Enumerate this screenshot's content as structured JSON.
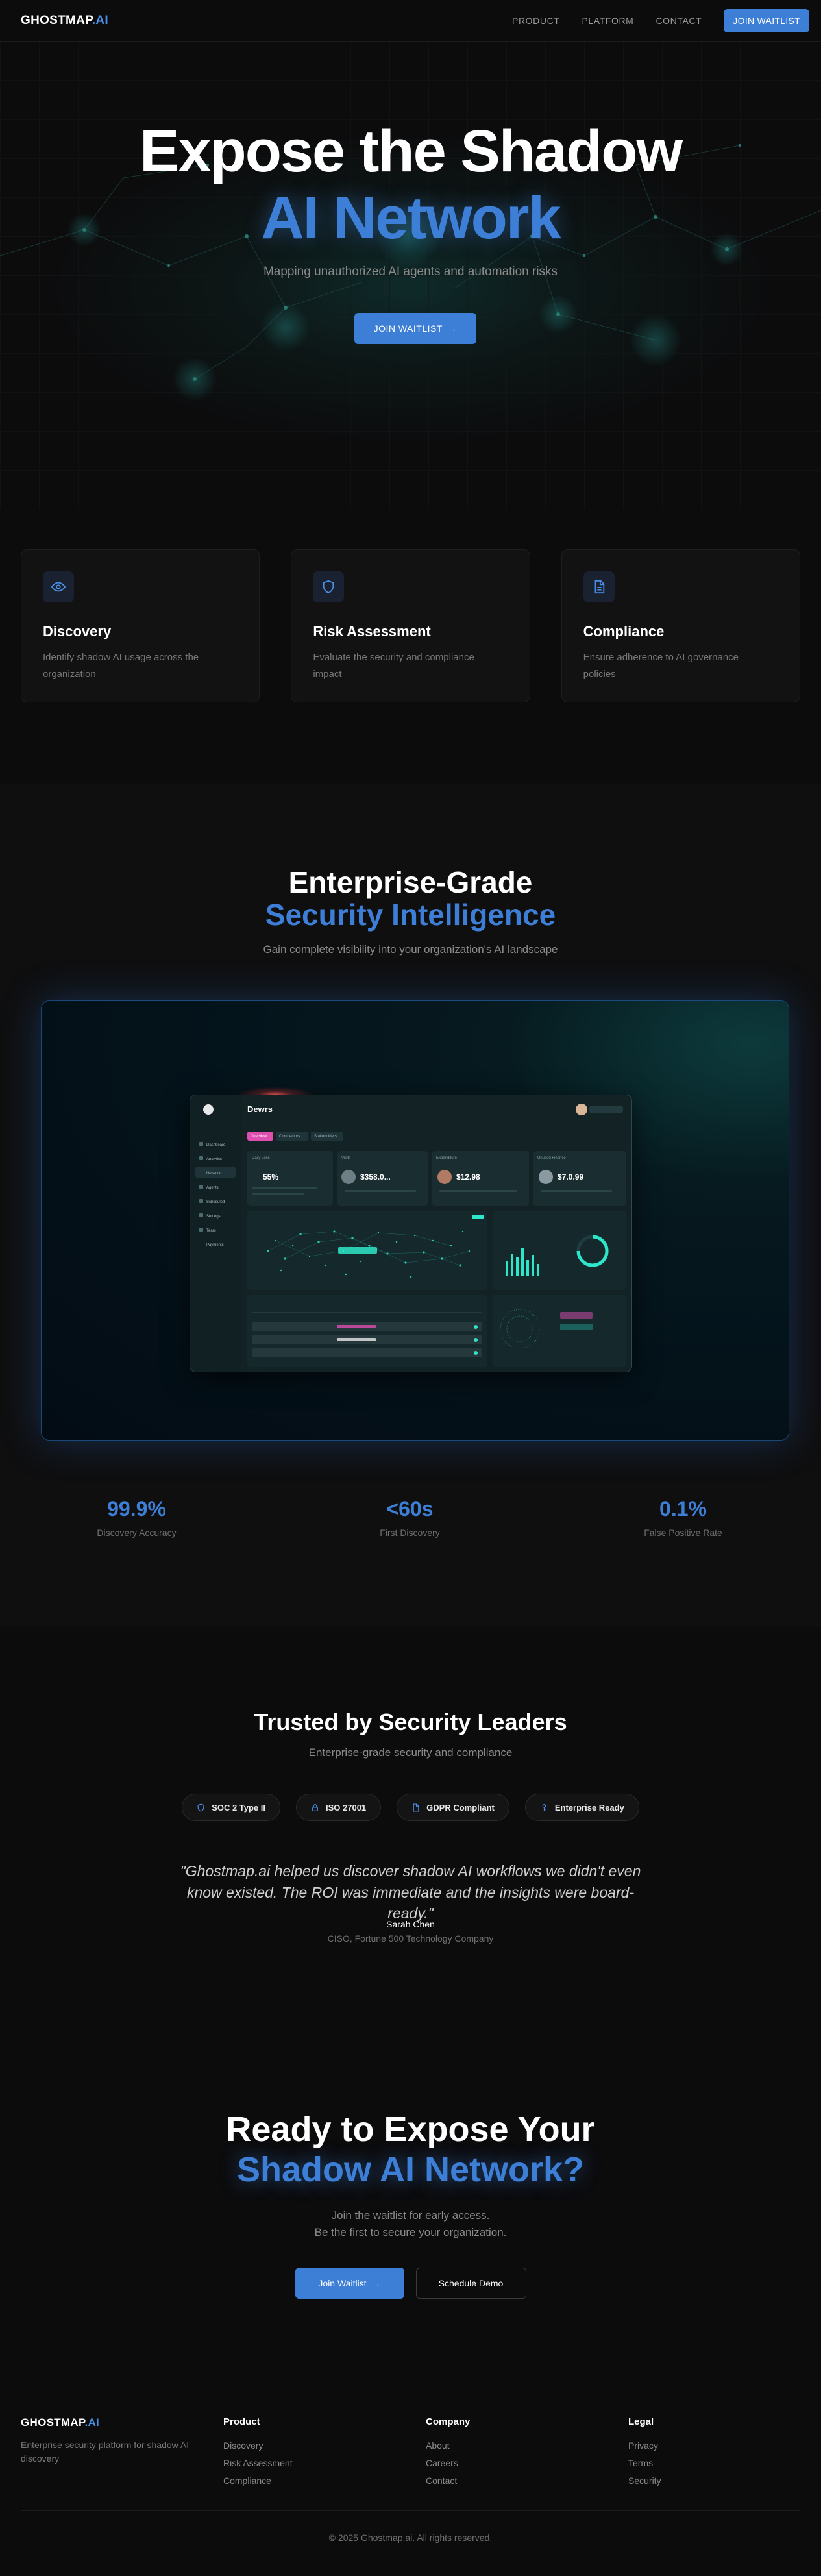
{
  "nav": {
    "logo_main": "GHOSTMAP",
    "logo_suffix": ".AI",
    "links": [
      "PRODUCT",
      "PLATFORM",
      "CONTACT"
    ],
    "cta": "JOIN WAITLIST"
  },
  "hero": {
    "title_line1": "Expose the Shadow",
    "title_line2": "AI Network",
    "subtitle": "Mapping unauthorized AI agents and automation risks",
    "cta": "JOIN WAITLIST"
  },
  "features": [
    {
      "icon": "eye-icon",
      "title": "Discovery",
      "desc": "Identify shadow AI usage across the organization"
    },
    {
      "icon": "shield-icon",
      "title": "Risk Assessment",
      "desc": "Evaluate the security and compliance impact"
    },
    {
      "icon": "document-icon",
      "title": "Compliance",
      "desc": "Ensure adherence to AI governance policies"
    }
  ],
  "enterprise": {
    "title_line1": "Enterprise-Grade",
    "title_line2": "Security Intelligence",
    "subtitle": "Gain complete visibility into your organization's AI landscape",
    "dashboard": {
      "brand": "Dewrs",
      "tabs": [
        "Overview",
        "Competitors",
        "Stakeholders"
      ],
      "sidebar": [
        "Dashboard",
        "Analytics",
        "Network",
        "Agents",
        "Scheduled",
        "Settings",
        "Team",
        "Payments"
      ],
      "cards": [
        {
          "label": "Daily Loss",
          "value": "55%"
        },
        {
          "label": "Visits",
          "value": "$358.0..."
        },
        {
          "label": "Expenditure",
          "value": "$12.98"
        },
        {
          "label": "Unused Finance",
          "value": "$7.0.99"
        }
      ]
    },
    "stats": [
      {
        "value": "99.9%",
        "label": "Discovery Accuracy"
      },
      {
        "value": "<60s",
        "label": "First Discovery"
      },
      {
        "value": "0.1%",
        "label": "False Positive Rate"
      }
    ]
  },
  "trust": {
    "title": "Trusted by Security Leaders",
    "subtitle": "Enterprise-grade security and compliance",
    "badges": [
      {
        "icon": "shield-icon",
        "label": "SOC 2 Type II"
      },
      {
        "icon": "lock-icon",
        "label": "ISO 27001"
      },
      {
        "icon": "document-icon",
        "label": "GDPR Compliant"
      },
      {
        "icon": "key-icon",
        "label": "Enterprise Ready"
      }
    ],
    "quote": "\"Ghostmap.ai helped us discover shadow AI workflows we didn't even know existed. The ROI was immediate and the insights were board-ready.\"",
    "author": "Sarah Chen",
    "role": "CISO, Fortune 500 Technology Company"
  },
  "cta": {
    "title_line1": "Ready to Expose Your",
    "title_line2": "Shadow AI Network?",
    "sub_line1": "Join the waitlist for early access.",
    "sub_line2": "Be the first to secure your organization.",
    "primary": "Join Waitlist",
    "secondary": "Schedule Demo"
  },
  "footer": {
    "logo_main": "GHOSTMAP",
    "logo_suffix": ".AI",
    "tagline": "Enterprise security platform for shadow AI discovery",
    "columns": [
      {
        "title": "Product",
        "links": [
          "Discovery",
          "Risk Assessment",
          "Compliance"
        ]
      },
      {
        "title": "Company",
        "links": [
          "About",
          "Careers",
          "Contact"
        ]
      },
      {
        "title": "Legal",
        "links": [
          "Privacy",
          "Terms",
          "Security"
        ]
      }
    ],
    "copyright": "© 2025 Ghostmap.ai. All rights reserved."
  },
  "colors": {
    "accent": "#3d7fd6",
    "background": "#0c0c0d"
  }
}
